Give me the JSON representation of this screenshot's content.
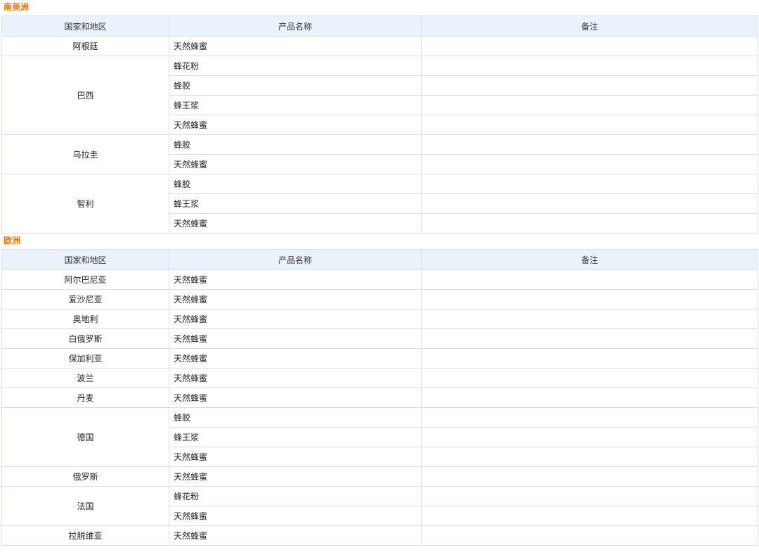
{
  "header": {
    "country": "国家和地区",
    "product": "产品名称",
    "note": "备注"
  },
  "regions": [
    {
      "title": "南美洲",
      "countries": [
        {
          "name": "阿根廷",
          "products": [
            "天然蜂蜜"
          ]
        },
        {
          "name": "巴西",
          "products": [
            "蜂花粉",
            "蜂胶",
            "蜂王浆",
            "天然蜂蜜"
          ]
        },
        {
          "name": "乌拉圭",
          "products": [
            "蜂胶",
            "天然蜂蜜"
          ]
        },
        {
          "name": "智利",
          "products": [
            "蜂胶",
            "蜂王浆",
            "天然蜂蜜"
          ]
        }
      ]
    },
    {
      "title": "欧洲",
      "countries": [
        {
          "name": "阿尔巴尼亚",
          "products": [
            "天然蜂蜜"
          ]
        },
        {
          "name": "爱沙尼亚",
          "products": [
            "天然蜂蜜"
          ]
        },
        {
          "name": "奥地利",
          "products": [
            "天然蜂蜜"
          ]
        },
        {
          "name": "白俄罗斯",
          "products": [
            "天然蜂蜜"
          ]
        },
        {
          "name": "保加利亚",
          "products": [
            "天然蜂蜜"
          ]
        },
        {
          "name": "波兰",
          "products": [
            "天然蜂蜜"
          ]
        },
        {
          "name": "丹麦",
          "products": [
            "天然蜂蜜"
          ]
        },
        {
          "name": "德国",
          "products": [
            "蜂胶",
            "蜂王浆",
            "天然蜂蜜"
          ]
        },
        {
          "name": "俄罗斯",
          "products": [
            "天然蜂蜜"
          ]
        },
        {
          "name": "法国",
          "products": [
            "蜂花粉",
            "天然蜂蜜"
          ]
        },
        {
          "name": "拉脱维亚",
          "products": [
            "天然蜂蜜"
          ]
        }
      ]
    }
  ]
}
